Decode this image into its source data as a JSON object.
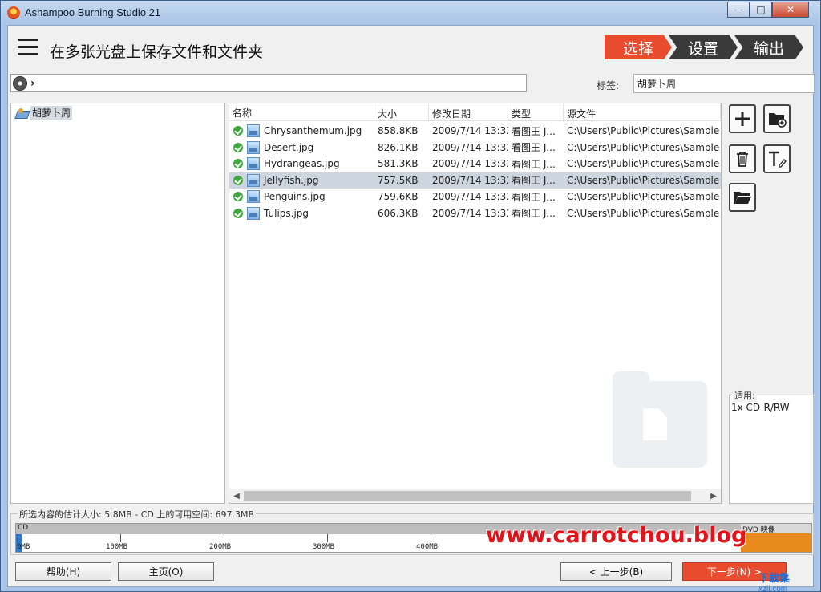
{
  "window": {
    "title": "Ashampoo Burning Studio 21",
    "controls": {
      "minimize": "—",
      "maximize": "□",
      "close": "✕"
    }
  },
  "header": {
    "page_title": "在多张光盘上保存文件和文件夹",
    "steps": [
      "选择",
      "设置",
      "输出"
    ],
    "active_step": 0
  },
  "pathbar": {
    "separator": "›"
  },
  "label_field": {
    "label": "标签:",
    "value": "胡萝卜周"
  },
  "tree": {
    "root_label": "胡萝卜周"
  },
  "filelist": {
    "columns": [
      "名称",
      "大小",
      "修改日期",
      "类型",
      "源文件"
    ],
    "rows": [
      {
        "name": "Chrysanthemum.jpg",
        "size": "858.8KB",
        "date": "2009/7/14 13:32",
        "type": "看图王 J...",
        "source": "C:\\Users\\Public\\Pictures\\Sample Pi",
        "selected": false
      },
      {
        "name": "Desert.jpg",
        "size": "826.1KB",
        "date": "2009/7/14 13:32",
        "type": "看图王 J...",
        "source": "C:\\Users\\Public\\Pictures\\Sample Pi",
        "selected": false
      },
      {
        "name": "Hydrangeas.jpg",
        "size": "581.3KB",
        "date": "2009/7/14 13:32",
        "type": "看图王 J...",
        "source": "C:\\Users\\Public\\Pictures\\Sample Pi",
        "selected": false
      },
      {
        "name": "Jellyfish.jpg",
        "size": "757.5KB",
        "date": "2009/7/14 13:32",
        "type": "看图王 J...",
        "source": "C:\\Users\\Public\\Pictures\\Sample Pi",
        "selected": true
      },
      {
        "name": "Penguins.jpg",
        "size": "759.6KB",
        "date": "2009/7/14 13:32",
        "type": "看图王 J...",
        "source": "C:\\Users\\Public\\Pictures\\Sample Pi",
        "selected": false
      },
      {
        "name": "Tulips.jpg",
        "size": "606.3KB",
        "date": "2009/7/14 13:32",
        "type": "看图王 J...",
        "source": "C:\\Users\\Public\\Pictures\\Sample Pi",
        "selected": false
      }
    ]
  },
  "toolbar": {
    "icons": [
      "add-icon",
      "new-folder-icon",
      "delete-icon",
      "rename-icon",
      "open-folder-icon"
    ]
  },
  "suitable": {
    "title": "适用:",
    "value": "1x CD-R/RW"
  },
  "capacity": {
    "summary": "所选内容的估计大小: 5.8MB - CD 上的可用空间: 697.3MB",
    "cd_label": "CD",
    "dvd_label": "DVD 映像",
    "ticks": [
      "0MB",
      "100MB",
      "200MB",
      "300MB",
      "400MB"
    ],
    "used_mb": 5.8,
    "cd_capacity_mb": 703.1
  },
  "footer": {
    "help": "帮助(H)",
    "home": "主页(O)",
    "back": "< 上一步(B)",
    "next": "下一步(N) >"
  },
  "watermark": {
    "url": "www.carrotchou.blog",
    "brand": "下载集",
    "brand_sub": "xzji.com"
  },
  "colors": {
    "accent": "#e94b2e",
    "selection": "#cdd5de",
    "ok": "#3ea83e",
    "dvd": "#e98a1c"
  }
}
